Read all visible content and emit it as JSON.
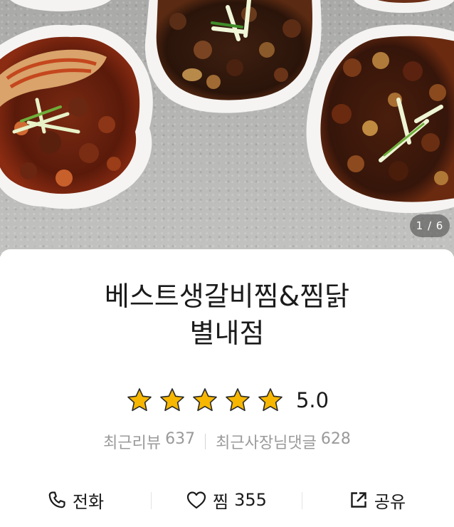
{
  "gallery": {
    "counter": "1 / 6",
    "image_description": "Braised galbi-jjim and jjimdak dishes in white fluted bowls on a grey stone surface"
  },
  "restaurant": {
    "name_line1": "베스트생갈비찜&찜닭",
    "name_line2": "별내점"
  },
  "rating": {
    "stars": 5,
    "value": "5.0",
    "star_color": "#f7b600"
  },
  "stats": {
    "reviews_label": "최근리뷰",
    "reviews_count": "637",
    "owner_replies_label": "최근사장님댓글",
    "owner_replies_count": "628"
  },
  "actions": {
    "call_label": "전화",
    "call_icon": "phone-icon",
    "like_label": "찜",
    "like_count": "355",
    "like_icon": "heart-icon",
    "share_label": "공유",
    "share_icon": "share-icon"
  }
}
